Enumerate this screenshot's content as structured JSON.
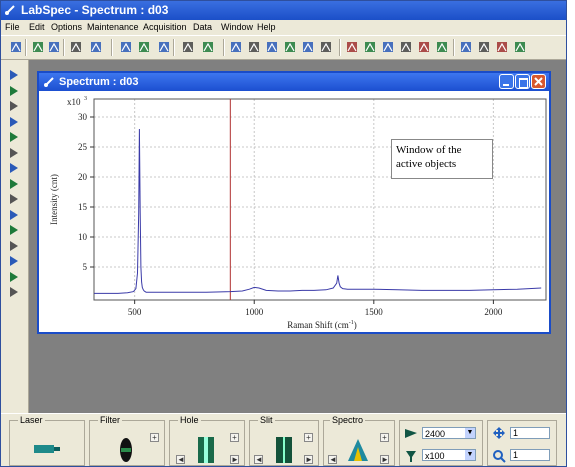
{
  "app": {
    "title": "LabSpec - Spectrum : d03"
  },
  "menu": [
    "File",
    "Edit",
    "Options",
    "Maintenance",
    "Acquisition",
    "Data",
    "Window",
    "Help"
  ],
  "toolbar_icons": [
    "display-icon",
    "open-icon",
    "save-icon",
    "print-icon",
    "help-icon",
    "move-icon",
    "cursor-icon",
    "scale-icon",
    "peak-icon",
    "baseline-icon",
    "spectrum-icon",
    "image-icon",
    "overlay-icon",
    "fit-icon",
    "grid-icon",
    "export-icon",
    "transfer-icon",
    "peaks-icon",
    "smooth-icon",
    "normalize-icon",
    "subtract-icon",
    "filter-icon",
    "multi-icon",
    "map-icon",
    "stats-icon",
    "zoom-icon"
  ],
  "left_tools": [
    "pointer-icon",
    "zoom-x-icon",
    "zoom-y-icon",
    "zoom-xy-icon",
    "shift-icon",
    "select-icon",
    "rect-icon",
    "line-icon",
    "marker-icon",
    "text-icon",
    "peak-label-icon",
    "move-icon",
    "magnify-icon",
    "user-icon",
    "grid-icon"
  ],
  "spectrum_window": {
    "title": "Spectrum : d03",
    "note": [
      "Window of the",
      "active objects"
    ],
    "multiplier": "x10",
    "multiplier_exp": "3"
  },
  "chart_data": {
    "type": "line",
    "title": "",
    "xlabel": "Raman Shift (cm",
    "xlabel_sup": "-1",
    "xlabel_close": ")",
    "ylabel": "Intensity (cnt)",
    "xlim": [
      330,
      2220
    ],
    "ylim": [
      -0.5,
      33
    ],
    "xticks": [
      500,
      1000,
      1500,
      2000
    ],
    "yticks": [
      5,
      10,
      15,
      20,
      25,
      30
    ],
    "cursor_x": 900,
    "series": [
      {
        "color": "#3a3aa8",
        "x": [
          330,
          380,
          430,
          470,
          495,
          505,
          512,
          517,
          520,
          523,
          526,
          529,
          532,
          536,
          540,
          548,
          560,
          580,
          620,
          700,
          800,
          900,
          950,
          980,
          1000,
          1020,
          1050,
          1100,
          1150,
          1200,
          1250,
          1300,
          1330,
          1345,
          1350,
          1355,
          1360,
          1370,
          1390,
          1420,
          1500,
          1600,
          1700,
          1800,
          1900,
          2000,
          2100,
          2200
        ],
        "y": [
          0.6,
          0.6,
          0.6,
          0.7,
          0.9,
          1.4,
          4,
          14,
          28,
          14,
          5,
          2.5,
          1.6,
          1.2,
          1.0,
          0.8,
          0.8,
          0.8,
          0.8,
          0.8,
          0.8,
          0.9,
          1.0,
          1.3,
          1.6,
          1.5,
          1.1,
          1.0,
          1.0,
          1.1,
          1.1,
          1.2,
          1.5,
          2.3,
          3.6,
          2.3,
          1.7,
          1.4,
          1.3,
          1.3,
          1.3,
          1.2,
          1.1,
          1.1,
          1.1,
          1.2,
          1.3,
          1.5
        ]
      }
    ]
  },
  "bottom": {
    "groups": [
      "Laser",
      "Filter",
      "Hole",
      "Slit",
      "Spectro"
    ],
    "grating": "2400",
    "objective": "x100",
    "field1": "1",
    "field2": "1",
    "plus": "+",
    "left": "◄",
    "right": "►",
    "down": "▼"
  }
}
